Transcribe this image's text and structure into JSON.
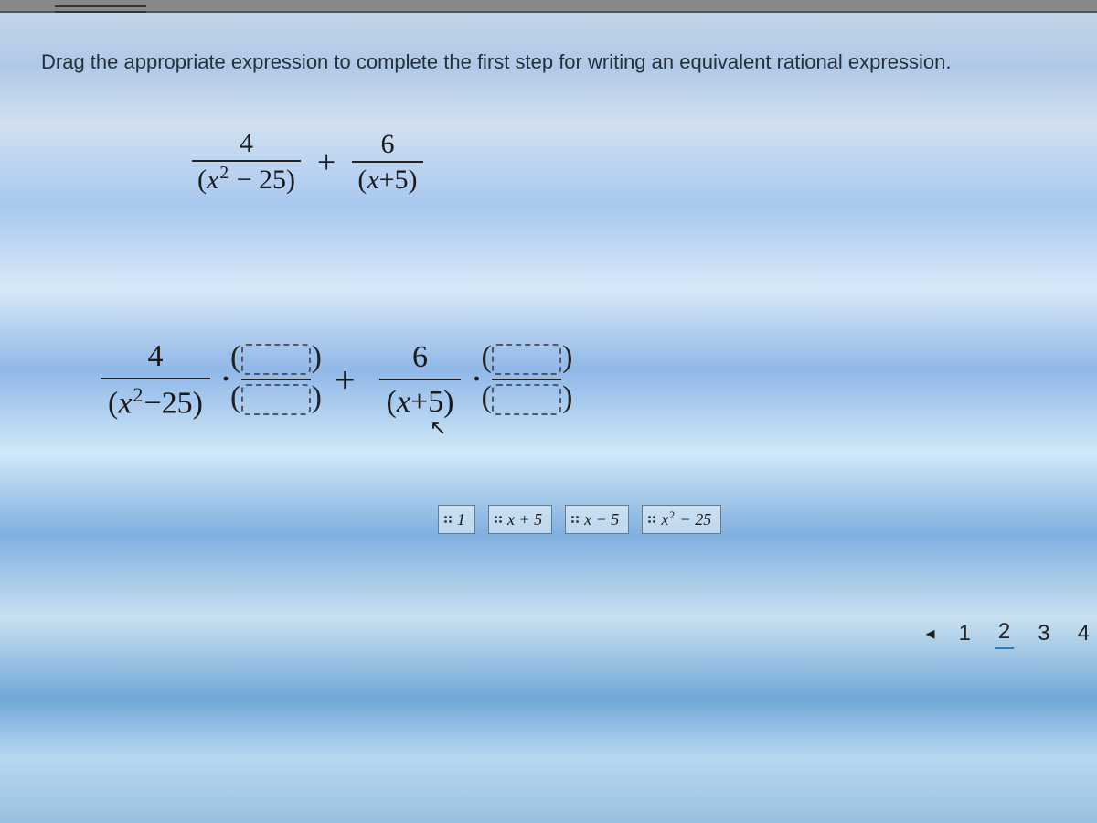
{
  "instruction": "Drag the appropriate expression to complete the first step for writing an equivalent rational expression.",
  "original": {
    "term1_num": "4",
    "term1_den": "(x² − 25)",
    "plus": "+",
    "term2_num": "6",
    "term2_den": "(x+5)"
  },
  "step": {
    "term1_num": "4",
    "term1_den": "(x² − 25)",
    "dot": "·",
    "plus": "+",
    "term2_num": "6",
    "term2_den": "(x+5)"
  },
  "tiles": [
    {
      "label": "1"
    },
    {
      "label": "x + 5"
    },
    {
      "label": "x − 5"
    },
    {
      "label": "x² − 25"
    }
  ],
  "pager": {
    "prev": "◂",
    "pages": [
      "1",
      "2",
      "3",
      "4"
    ],
    "active": "2"
  }
}
